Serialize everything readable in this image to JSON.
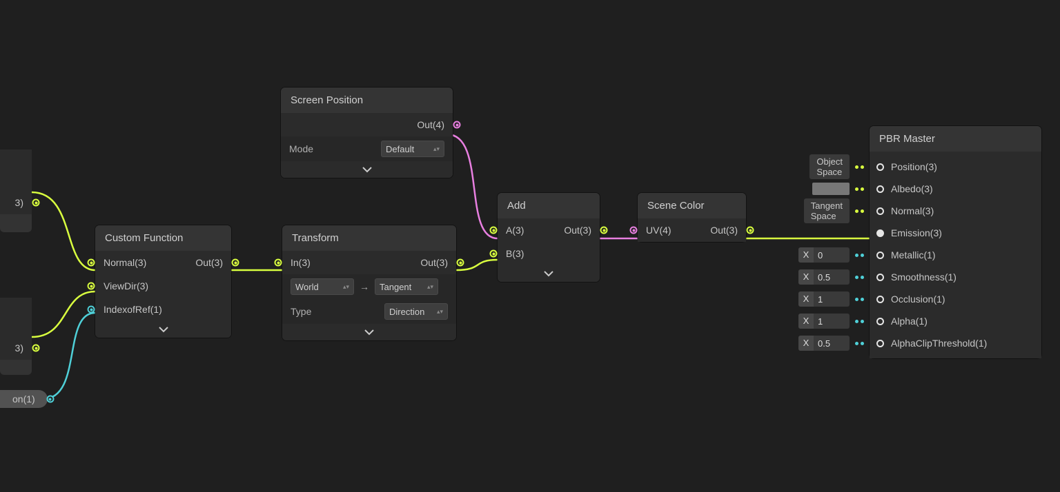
{
  "stubs": {
    "a": {
      "label": "3)"
    },
    "b": {
      "label": "3)"
    },
    "c": {
      "label": "on(1)"
    }
  },
  "customFunction": {
    "title": "Custom Function",
    "ports": {
      "normal": "Normal(3)",
      "viewdir": "ViewDir(3)",
      "ior": "IndexofRef(1)",
      "out": "Out(3)"
    }
  },
  "screenPosition": {
    "title": "Screen Position",
    "out": "Out(4)",
    "modeLabel": "Mode",
    "mode": "Default"
  },
  "transform": {
    "title": "Transform",
    "in": "In(3)",
    "out": "Out(3)",
    "from": "World",
    "to": "Tangent",
    "typeLabel": "Type",
    "type": "Direction"
  },
  "add": {
    "title": "Add",
    "a": "A(3)",
    "b": "B(3)",
    "out": "Out(3)"
  },
  "sceneColor": {
    "title": "Scene Color",
    "uv": "UV(4)",
    "out": "Out(3)"
  },
  "pbr": {
    "title": "PBR Master",
    "inputs": [
      {
        "name": "Position(3)",
        "chip": {
          "type": "pill",
          "text": "Object Space"
        },
        "dots": [
          "#d9ff3f",
          "#d9ff3f"
        ]
      },
      {
        "name": "Albedo(3)",
        "chip": {
          "type": "swatch"
        },
        "dots": [
          "#d9ff3f",
          "#d9ff3f"
        ]
      },
      {
        "name": "Normal(3)",
        "chip": {
          "type": "pill",
          "text": "Tangent Space"
        },
        "dots": [
          "#d9ff3f",
          "#d9ff3f"
        ]
      },
      {
        "name": "Emission(3)",
        "chip": null,
        "dots": [],
        "connected": true
      },
      {
        "name": "Metallic(1)",
        "chip": {
          "type": "x",
          "v": "0"
        },
        "dots": [
          "#4fd0d8",
          "#4fd0d8"
        ]
      },
      {
        "name": "Smoothness(1)",
        "chip": {
          "type": "x",
          "v": "0.5"
        },
        "dots": [
          "#4fd0d8",
          "#4fd0d8"
        ]
      },
      {
        "name": "Occlusion(1)",
        "chip": {
          "type": "x",
          "v": "1"
        },
        "dots": [
          "#4fd0d8",
          "#4fd0d8"
        ]
      },
      {
        "name": "Alpha(1)",
        "chip": {
          "type": "x",
          "v": "1"
        },
        "dots": [
          "#4fd0d8",
          "#4fd0d8"
        ]
      },
      {
        "name": "AlphaClipThreshold(1)",
        "chip": {
          "type": "x",
          "v": "0.5"
        },
        "dots": [
          "#4fd0d8",
          "#4fd0d8"
        ]
      }
    ]
  }
}
